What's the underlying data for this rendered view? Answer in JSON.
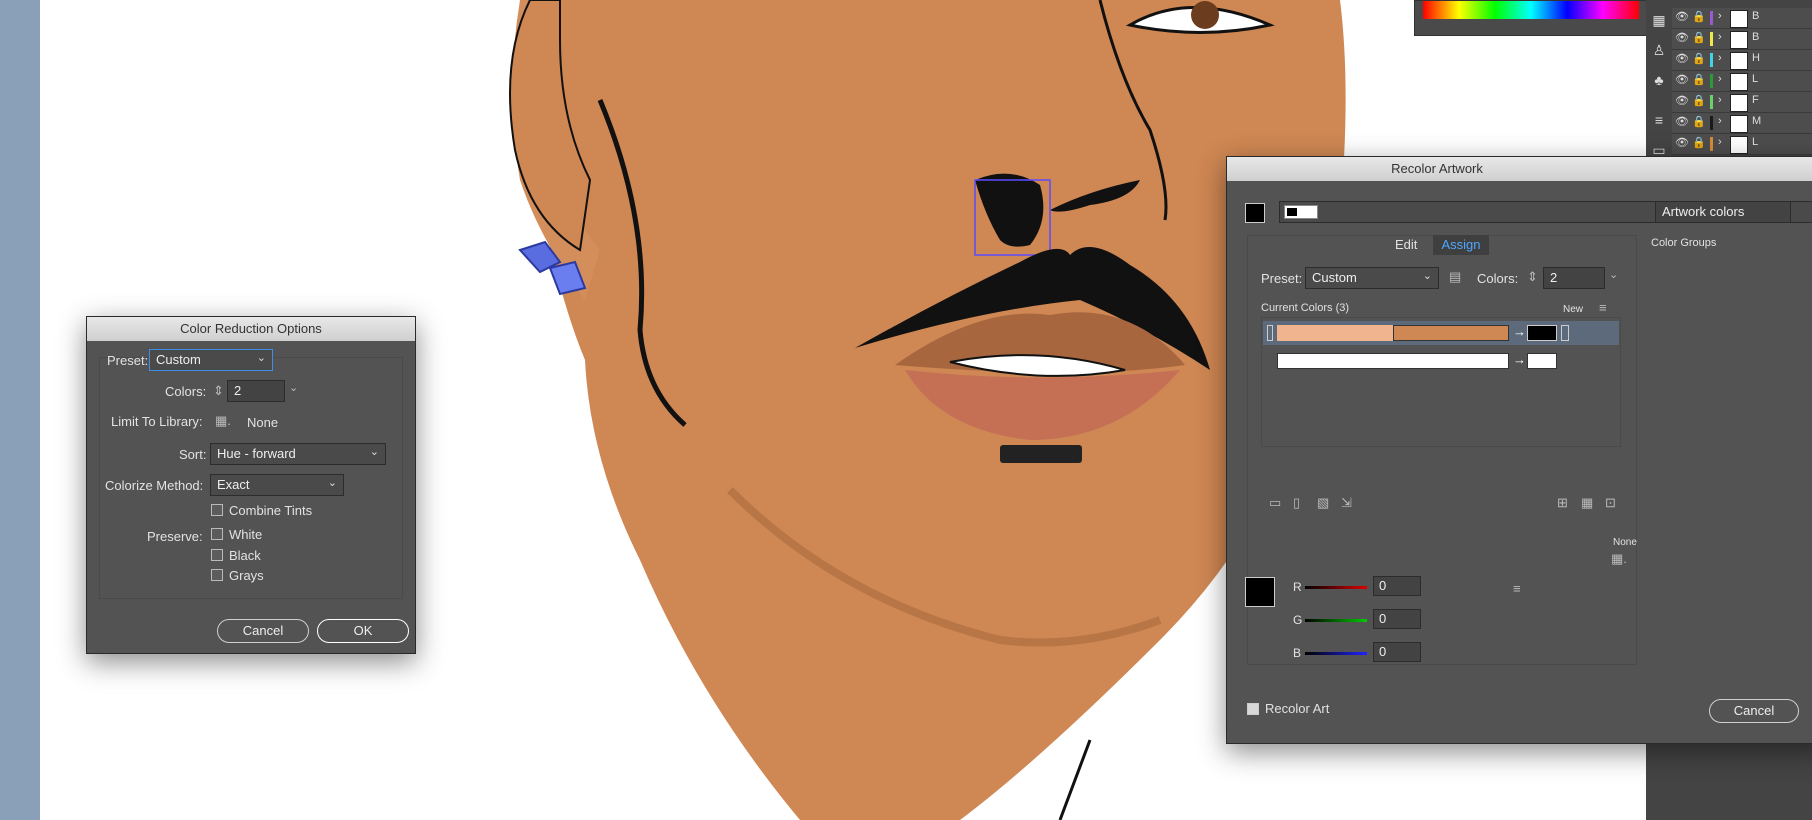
{
  "color_reduction": {
    "title": "Color Reduction Options",
    "preset_label": "Preset:",
    "preset_value": "Custom",
    "colors_label": "Colors:",
    "colors_value": "2",
    "limit_label": "Limit To Library:",
    "limit_value": "None",
    "sort_label": "Sort:",
    "sort_value": "Hue - forward",
    "colorize_label": "Colorize Method:",
    "colorize_value": "Exact",
    "combine_tints": "Combine Tints",
    "preserve_label": "Preserve:",
    "preserve_white": "White",
    "preserve_black": "Black",
    "preserve_grays": "Grays",
    "cancel": "Cancel",
    "ok": "OK"
  },
  "recolor": {
    "title": "Recolor Artwork",
    "artwork_colors": "Artwork colors",
    "tab_edit": "Edit",
    "tab_assign": "Assign",
    "preset_label": "Preset:",
    "preset_value": "Custom",
    "colors_label": "Colors:",
    "colors_value": "2",
    "current_colors": "Current Colors (3)",
    "new_label": "New",
    "color_groups": "Color Groups",
    "none_label": "None",
    "r_label": "R",
    "g_label": "G",
    "b_label": "B",
    "r_value": "0",
    "g_value": "0",
    "b_value": "0",
    "recolor_art": "Recolor Art",
    "cancel": "Cancel"
  },
  "layers": [
    {
      "name": "B",
      "color": "#9b59d0"
    },
    {
      "name": "B",
      "color": "#f0e84a"
    },
    {
      "name": "H",
      "color": "#3fd3e8"
    },
    {
      "name": "L",
      "color": "#2a9a3a"
    },
    {
      "name": "F",
      "color": "#6ad06a"
    },
    {
      "name": "M",
      "color": "#1a1a1a"
    },
    {
      "name": "L",
      "color": "#d88a3a"
    }
  ]
}
